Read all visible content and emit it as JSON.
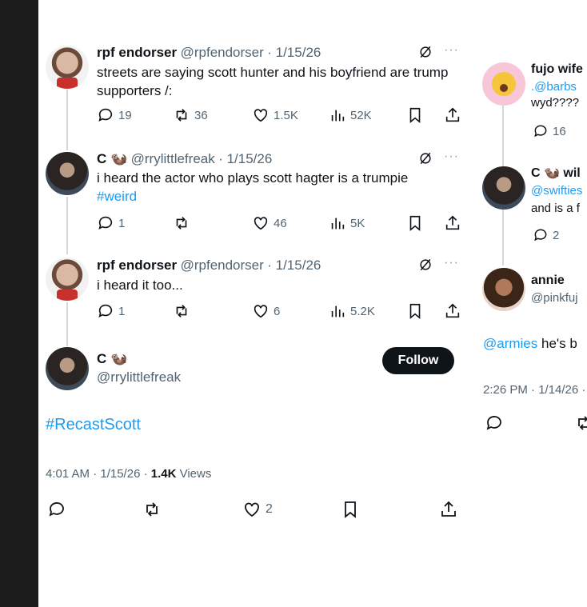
{
  "thread": [
    {
      "name": "rpf endorser",
      "handle": "@rpfendorser",
      "date": "· 1/15/26",
      "text": "streets are saying scott hunter and his boyfriend are trump supporters /:",
      "replies": "19",
      "reposts": "36",
      "likes": "1.5K",
      "views": "52K"
    },
    {
      "name": "C 🦦",
      "handle": "@rrylittlefreak",
      "date": "· 1/15/26",
      "text": "i heard the actor who plays scott hagter is a trumpie",
      "hashtag": "#weird",
      "replies": "1",
      "reposts": "",
      "likes": "46",
      "views": "5K"
    },
    {
      "name": "rpf endorser",
      "handle": "@rpfendorser",
      "date": "· 1/15/26",
      "text": "i heard it too...",
      "replies": "1",
      "reposts": "",
      "likes": "6",
      "views": "5.2K"
    }
  ],
  "main": {
    "name": "C 🦦",
    "handle": "@rrylittlefreak",
    "follow_label": "Follow",
    "text": "#RecastScott",
    "time": "4:01 AM · 1/15/26 · ",
    "views_count": "1.4K",
    "views_label": " Views",
    "likes": "2"
  },
  "right": {
    "tweet1": {
      "name": "fujo wife",
      "line1": ".@barbs",
      "line2": "wyd????",
      "replies": "16"
    },
    "tweet2": {
      "name": "C 🦦 wil",
      "line1": "@swifties",
      "line2": "and is a f",
      "replies": "2"
    },
    "tweet3": {
      "name": "annie",
      "handle": "@pinkfuj"
    },
    "mention": "@armies",
    "mention_rest": " he's b",
    "time": "2:26 PM · 1/14/26 ·"
  },
  "icons": {
    "reply": "reply-icon",
    "repost": "repost-icon",
    "like": "heart-icon",
    "views": "views-icon",
    "bookmark": "bookmark-icon",
    "share": "share-icon",
    "grok": "grok-icon",
    "more": "more-icon"
  },
  "colors": {
    "link": "#1d9bf0",
    "muted": "#536471",
    "text": "#0f1419",
    "thread_line": "#cfd9de"
  }
}
